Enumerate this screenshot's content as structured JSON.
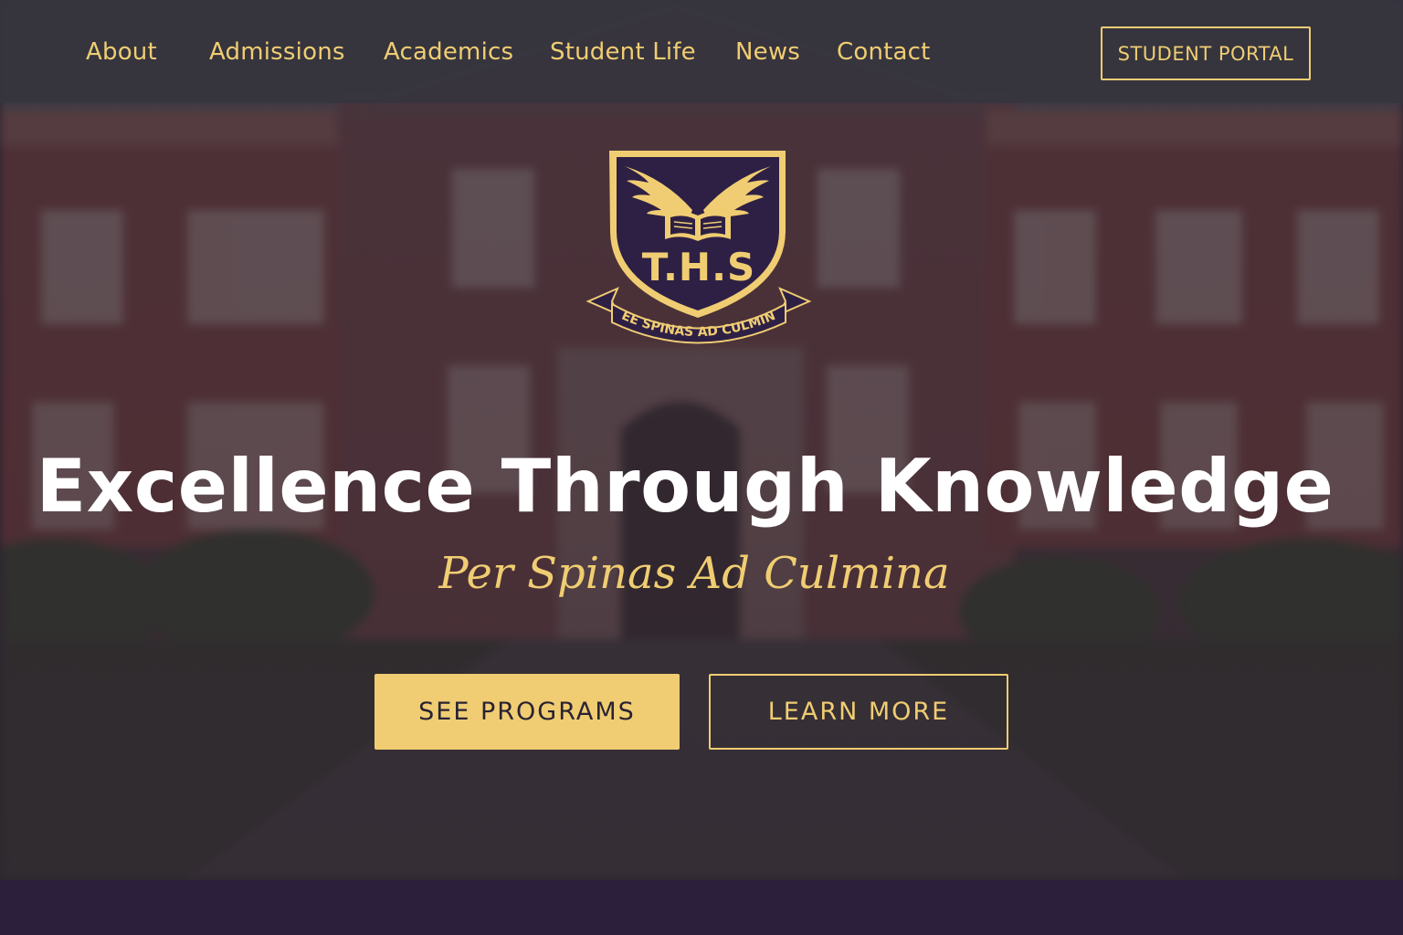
{
  "nav": {
    "links": [
      {
        "label": "About"
      },
      {
        "label": "Admissions"
      },
      {
        "label": "Academics"
      },
      {
        "label": "Student Life"
      },
      {
        "label": "News"
      },
      {
        "label": "Contact"
      }
    ],
    "portal_button": "STUDENT PORTAL"
  },
  "crest": {
    "initials": "T.H.S",
    "motto_banner": "PEE SPINAS AD CULMINA",
    "icon": "winged-book-shield-crest"
  },
  "hero": {
    "headline": "Excellence Through Knowledge",
    "tagline": "Per Spinas Ad Culmina",
    "primary_button": "SEE PROGRAMS",
    "secondary_button": "LEARN MORE"
  },
  "colors": {
    "accent_gold": "#f0cd72",
    "navy_purple": "#2e2045",
    "bottom_band": "#2b1f3b",
    "text_white": "#ffffff"
  }
}
